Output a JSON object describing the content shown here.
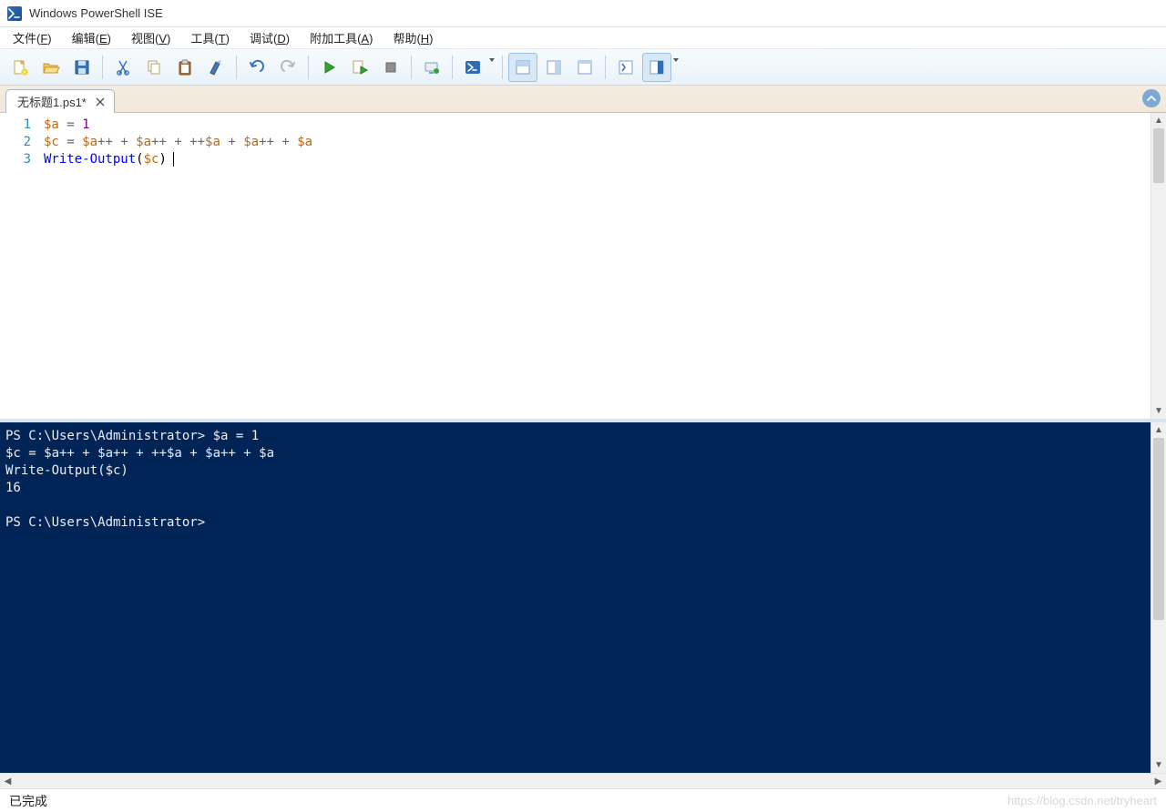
{
  "titlebar": {
    "app_title": "Windows PowerShell ISE"
  },
  "menubar": {
    "items": [
      {
        "label": "文件",
        "accel": "F"
      },
      {
        "label": "编辑",
        "accel": "E"
      },
      {
        "label": "视图",
        "accel": "V"
      },
      {
        "label": "工具",
        "accel": "T"
      },
      {
        "label": "调试",
        "accel": "D"
      },
      {
        "label": "附加工具",
        "accel": "A"
      },
      {
        "label": "帮助",
        "accel": "H"
      }
    ]
  },
  "toolbar": {
    "new_name": "new-file-icon",
    "open_name": "open-folder-icon",
    "save_name": "save-icon",
    "cut_name": "cut-icon",
    "copy_name": "copy-icon",
    "paste_name": "paste-icon",
    "clear_name": "clear-icon",
    "undo_name": "undo-icon",
    "redo_name": "redo-icon",
    "run_name": "run-icon",
    "run_selection_name": "run-selection-icon",
    "stop_name": "stop-icon",
    "remote_name": "new-remote-tab-icon",
    "ps_name": "powershell-icon",
    "layout1_name": "layout-script-top-icon",
    "layout2_name": "layout-script-right-icon",
    "layout3_name": "layout-script-max-icon",
    "cmd_addon_name": "command-addon-icon",
    "show_cmd_name": "show-command-pane-icon"
  },
  "tab": {
    "label": "无标题1.ps1*"
  },
  "editor": {
    "lines": [
      {
        "num": "1",
        "tokens": [
          {
            "t": "$a",
            "c": "var"
          },
          {
            "t": " = ",
            "c": "op"
          },
          {
            "t": "1",
            "c": "num"
          }
        ]
      },
      {
        "num": "2",
        "tokens": [
          {
            "t": "$c",
            "c": "var"
          },
          {
            "t": " = ",
            "c": "op"
          },
          {
            "t": "$a",
            "c": "var"
          },
          {
            "t": "++ + ",
            "c": "op"
          },
          {
            "t": "$a",
            "c": "var"
          },
          {
            "t": "++ + ++",
            "c": "op"
          },
          {
            "t": "$a",
            "c": "var"
          },
          {
            "t": " + ",
            "c": "op"
          },
          {
            "t": "$a",
            "c": "var"
          },
          {
            "t": "++ + ",
            "c": "op"
          },
          {
            "t": "$a",
            "c": "var"
          }
        ]
      },
      {
        "num": "3",
        "tokens": [
          {
            "t": "Write-Output",
            "c": "cmd"
          },
          {
            "t": "(",
            "c": "par"
          },
          {
            "t": "$c",
            "c": "var"
          },
          {
            "t": ")",
            "c": "par"
          }
        ],
        "caret": true
      }
    ]
  },
  "console": {
    "lines": [
      "PS C:\\Users\\Administrator> $a = 1",
      "$c = $a++ + $a++ + ++$a + $a++ + $a",
      "Write-Output($c)",
      "16",
      "",
      "PS C:\\Users\\Administrator> "
    ]
  },
  "statusbar": {
    "status": "已完成",
    "watermark": "https://blog.csdn.net/tryheart"
  }
}
